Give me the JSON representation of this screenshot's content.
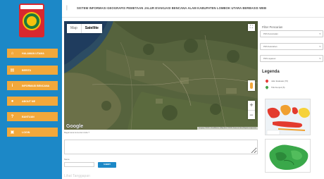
{
  "header": {
    "title": "SISTEM INFORMASI GEOGRAFIS PEMETAAN JALUR EVAKUASI BENCANA ALAM KABUPATEN LOMBOK UTARA BERBASIS WEB",
    "menu_icon": "menu-icon"
  },
  "sidebar": {
    "logo_icon": "lombok-utara-seal",
    "items": [
      {
        "label": "HALAMAN UTAMA",
        "icon": "home-icon"
      },
      {
        "label": "BERITA",
        "icon": "newspaper-icon"
      },
      {
        "label": "INFORMASI BENCANA",
        "icon": "info-icon"
      },
      {
        "label": "ABOUT ME",
        "icon": "user-icon"
      },
      {
        "label": "BANTUAN",
        "icon": "question-icon"
      },
      {
        "label": "LOGIN",
        "icon": "lock-icon"
      }
    ],
    "colors": {
      "background": "#1c88c7",
      "item": "#f2a83b"
    }
  },
  "map": {
    "types": [
      "Map",
      "Satellite"
    ],
    "selected_type": "Satellite",
    "google_label": "Google",
    "attribution": "Imagery ©2019 , TerraMetrics | Map data ©2019 | Terms of Use | Report a map error",
    "zoom_in": "+",
    "zoom_out": "−"
  },
  "comment_form": {
    "comment_label": "Bagaimana komentar Anda ?",
    "name_label": "Nama",
    "submit_label": "SUBMIT"
  },
  "footer": {
    "text": "Lihat Tanggapan"
  },
  "filter_panel": {
    "title": "Filter Pencarian",
    "selects": [
      {
        "value": "Pilih Kecamatan"
      },
      {
        "value": "Pilih Kelurahan"
      },
      {
        "value": "Pilih Layanan"
      }
    ]
  },
  "legend": {
    "title": "Legenda",
    "items": [
      {
        "label": "Jalur Evakuasi (70)",
        "color": "#e53935"
      },
      {
        "label": "Titik Kumpul (5)",
        "color": "#43a047"
      }
    ]
  }
}
